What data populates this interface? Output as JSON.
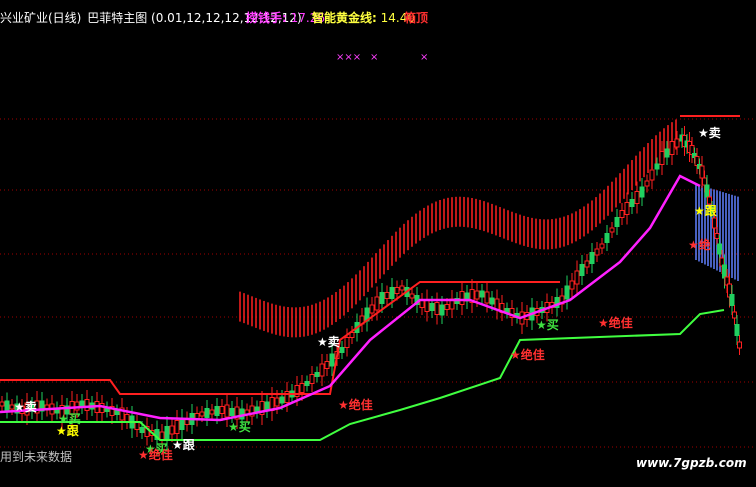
{
  "header": {
    "stock_title": "兴业矿业(日线)",
    "indicator_name": "巴菲特主图",
    "params": "(0.01,12,12,12,12,12,12)",
    "money_label": "捞钱手:",
    "money_value": "17.26",
    "gold_label": "智能黄金线:",
    "gold_value": "14.40",
    "box_top_label": "箱顶"
  },
  "markers": {
    "x_marks": "×××",
    "x_mark_single_1": "×",
    "x_mark_single_2": "×"
  },
  "signals": [
    {
      "id": "sell-1",
      "label": "★卖",
      "color": "#ffffff"
    },
    {
      "id": "follow-1",
      "label": "★跟",
      "color": "#ffff00"
    },
    {
      "id": "jue-1",
      "label": "★绝",
      "color": "#ff3030"
    },
    {
      "id": "sell-2",
      "label": "★卖",
      "color": "#ffffff"
    },
    {
      "id": "jue-jia-1",
      "label": "★绝佳",
      "color": "#ff3030"
    },
    {
      "id": "jue-jia-2",
      "label": "★绝佳",
      "color": "#ff3030"
    },
    {
      "id": "buy-1",
      "label": "★买",
      "color": "#40e040"
    },
    {
      "id": "buy-2",
      "label": "★买",
      "color": "#40e040"
    },
    {
      "id": "jue-jia-3",
      "label": "★绝佳",
      "color": "#ff3030"
    },
    {
      "id": "buy-3",
      "label": "★买",
      "color": "#40e040"
    },
    {
      "id": "follow-2",
      "label": "★跟",
      "color": "#ffff00"
    },
    {
      "id": "buy-4",
      "label": "★买",
      "color": "#40e040"
    },
    {
      "id": "jue-jia-4",
      "label": "★绝佳",
      "color": "#ff3030"
    },
    {
      "id": "follow-3",
      "label": "★跟",
      "color": "#ffffff"
    },
    {
      "id": "sell-3",
      "label": "★卖",
      "color": "#ffffff"
    }
  ],
  "footer": {
    "future_data": "用到未来数据",
    "watermark": "www.7gpzb.com"
  },
  "colors": {
    "background": "#000000",
    "up_candle": "#ff2020",
    "down_candle": "#20d060",
    "magenta_line": "#ff20ff",
    "green_support": "#40ff40",
    "red_resistance": "#ff2020",
    "grid": "#a00000",
    "header_title": "#ffffff",
    "header_param": "#ffffff",
    "money": "#ff40ff",
    "gold": "#ffff40"
  }
}
